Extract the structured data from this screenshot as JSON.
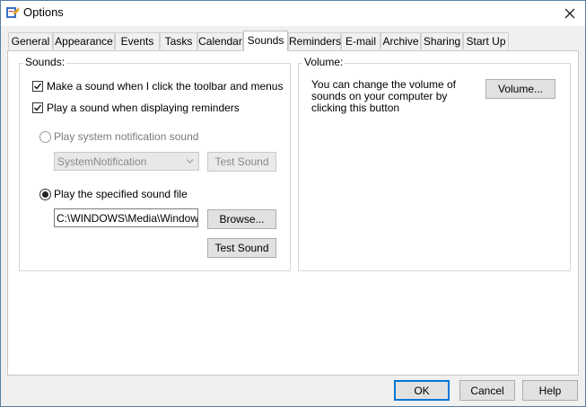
{
  "window": {
    "title": "Options"
  },
  "tabs": [
    {
      "label": "General"
    },
    {
      "label": "Appearance"
    },
    {
      "label": "Events"
    },
    {
      "label": "Tasks"
    },
    {
      "label": "Calendar"
    },
    {
      "label": "Sounds",
      "active": true
    },
    {
      "label": "Reminders"
    },
    {
      "label": "E-mail"
    },
    {
      "label": "Archive"
    },
    {
      "label": "Sharing"
    },
    {
      "label": "Start Up"
    }
  ],
  "sounds": {
    "group_label": "Sounds:",
    "toolbar_sound_label": "Make a sound when I click the toolbar and menus",
    "toolbar_sound_checked": true,
    "reminder_sound_label": "Play a sound when displaying reminders",
    "reminder_sound_checked": true,
    "system_sound_label": "Play system notification sound",
    "system_sound_selected": false,
    "system_sound_value": "SystemNotification",
    "test_sound_1": "Test Sound",
    "file_sound_label": "Play the specified sound file",
    "file_sound_selected": true,
    "file_path": "C:\\WINDOWS\\Media\\Windows N",
    "browse_label": "Browse...",
    "test_sound_2": "Test Sound"
  },
  "volume": {
    "group_label": "Volume:",
    "description": "You can change the volume of sounds on your computer by clicking this button",
    "button_label": "Volume..."
  },
  "footer": {
    "ok": "OK",
    "cancel": "Cancel",
    "help": "Help"
  },
  "colors": {
    "accent": "#0078d7",
    "window_border": "#5a7fa6"
  }
}
